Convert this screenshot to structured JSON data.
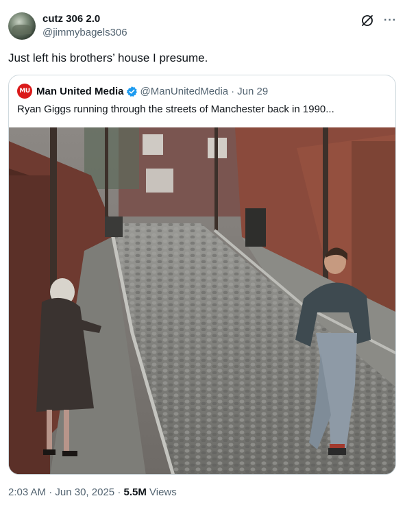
{
  "author": {
    "display_name": "cutz 306 2.0",
    "handle": "@jimmybagels306"
  },
  "tweet": {
    "text": "Just left his brothers’ house I presume."
  },
  "quoted": {
    "avatar_text": "MU",
    "display_name": "Man United Media",
    "handle": "@ManUnitedMedia",
    "separator": "·",
    "date": "Jun 29",
    "text": "Ryan Giggs running through the streets of Manchester back in 1990...",
    "verified_color": "#1d9bf0",
    "avatar_color": "#da1a1a"
  },
  "meta": {
    "time": "2:03 AM",
    "sep1": "·",
    "date": "Jun 30, 2025",
    "sep2": "·",
    "views_count": "5.5M",
    "views_label": "Views"
  },
  "icons": {
    "grok": "grok-icon",
    "more": "more-icon",
    "verified": "verified-badge-icon"
  }
}
